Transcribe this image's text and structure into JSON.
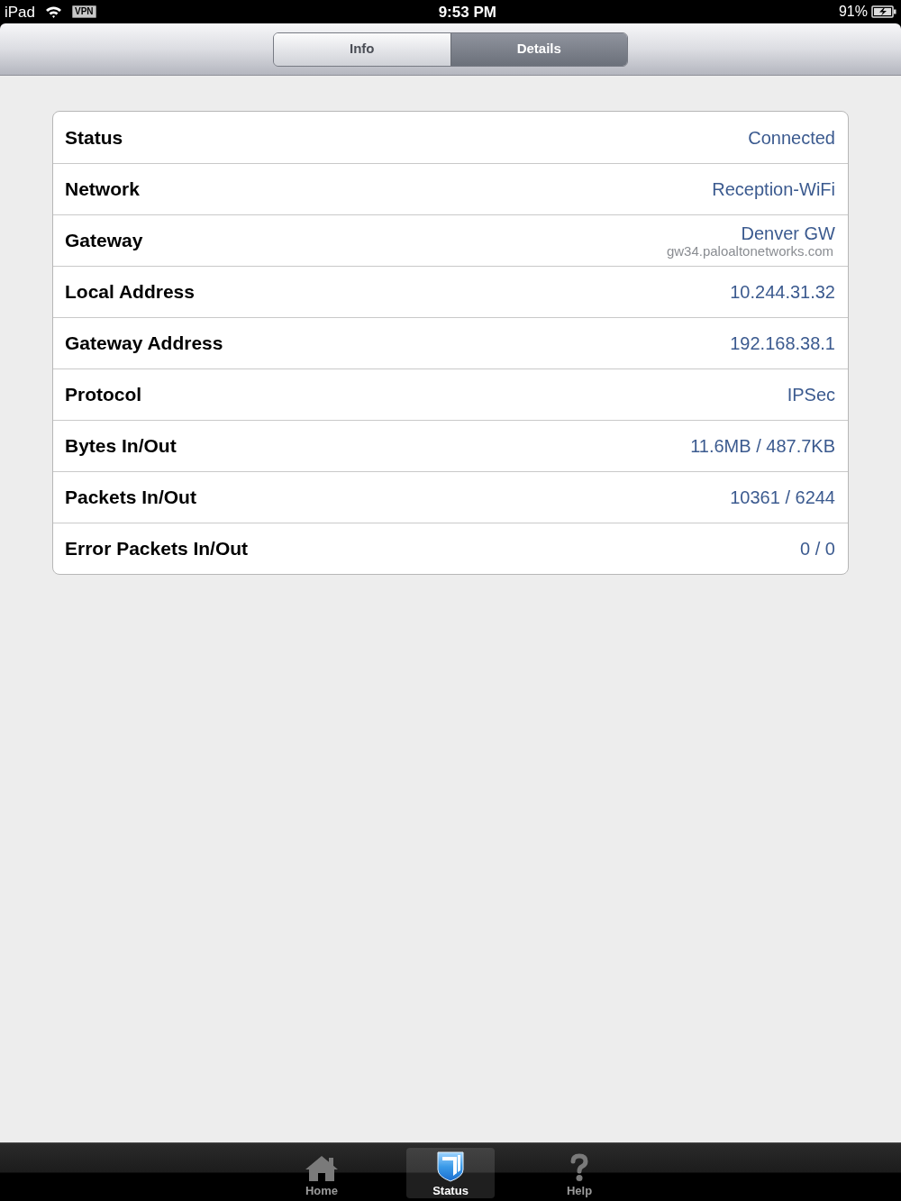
{
  "status_bar": {
    "device": "iPad",
    "vpn_badge": "VPN",
    "time": "9:53 PM",
    "battery": "91%"
  },
  "segmented_control": [
    {
      "label": "Info",
      "selected": false
    },
    {
      "label": "Details",
      "selected": true
    }
  ],
  "details": [
    {
      "label": "Status",
      "value": "Connected"
    },
    {
      "label": "Network",
      "value": "Reception-WiFi"
    },
    {
      "label": "Gateway",
      "value": "Denver GW",
      "subtitle": "gw34.paloaltonetworks.com"
    },
    {
      "label": "Local Address",
      "value": "10.244.31.32"
    },
    {
      "label": "Gateway Address",
      "value": "192.168.38.1"
    },
    {
      "label": "Protocol",
      "value": "IPSec"
    },
    {
      "label": "Bytes In/Out",
      "value": "11.6MB / 487.7KB"
    },
    {
      "label": "Packets In/Out",
      "value": "10361 / 6244"
    },
    {
      "label": "Error Packets In/Out",
      "value": "0 / 0"
    }
  ],
  "tab_bar": [
    {
      "kind": "home",
      "label": "Home",
      "selected": false
    },
    {
      "kind": "shield",
      "label": "Status",
      "selected": true
    },
    {
      "kind": "help",
      "label": "Help",
      "selected": false
    }
  ]
}
